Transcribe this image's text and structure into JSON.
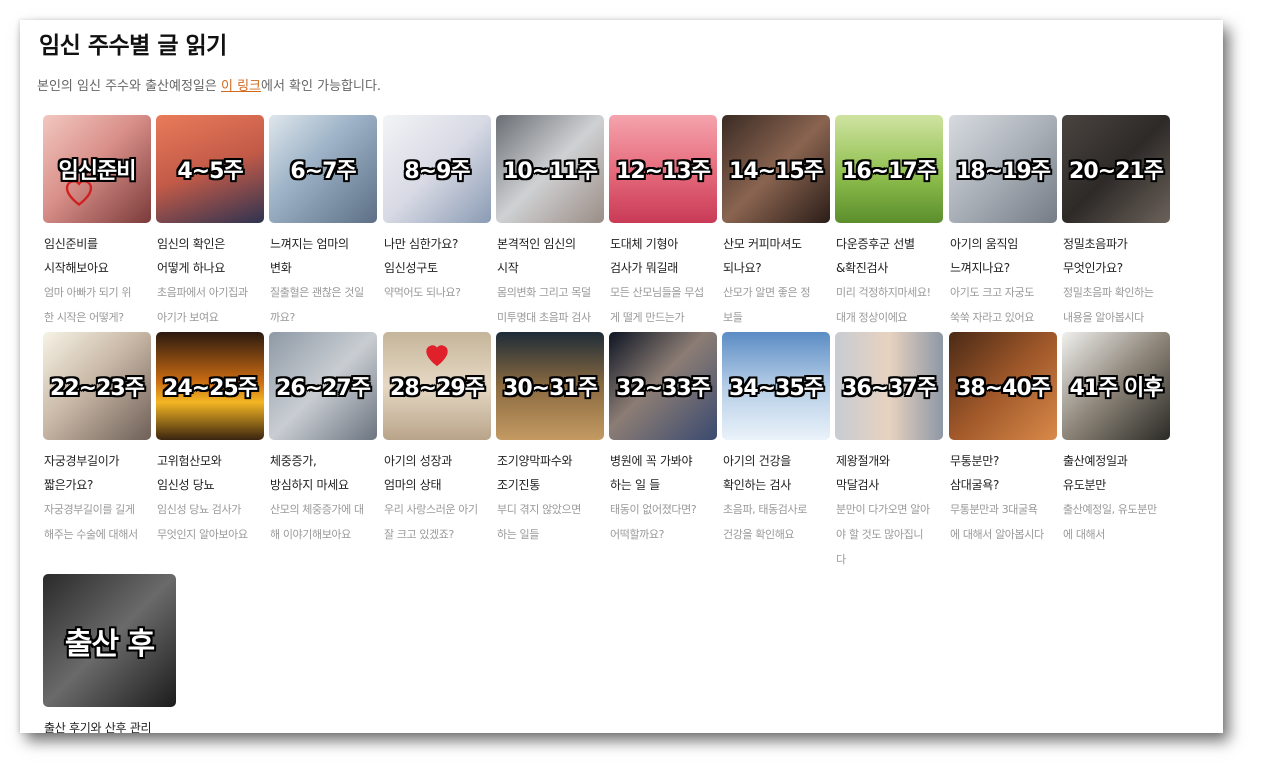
{
  "page": {
    "title": "임신 주수별 글 읽기",
    "intro_prefix": "본인의 임신 주수와 출산예정일은 ",
    "intro_link": "이 링크",
    "intro_suffix": "에서 확인 가능합니다."
  },
  "cards": [
    {
      "label": "임신준비",
      "title": "임신준비를\n시작해보아요",
      "desc": "엄마 아빠가 되기 위\n한 시작은 어떻게?",
      "bg": "linear-gradient(135deg,#f2c7c0 0%,#d98f89 45%,#7a3b3a 100%)"
    },
    {
      "label": "4~5주",
      "title": "임신의 확인은\n어떻게 하나요",
      "desc": "초음파에서 아기집과\n아기가 보여요",
      "bg": "linear-gradient(160deg,#e97b5a 0%,#c25a48 50%,#2e3350 100%)"
    },
    {
      "label": "6~7주",
      "title": "느껴지는 엄마의\n변화",
      "desc": "질출혈은 괜찮은 것일\n까요?",
      "bg": "linear-gradient(135deg,#dfe6ec 0%,#9fb4c8 40%,#5c6f86 100%)"
    },
    {
      "label": "8~9주",
      "title": "나만 심한가요?\n임신성구토",
      "desc": "약먹어도 되나요?",
      "bg": "linear-gradient(135deg,#f3f4f6 0%,#d7d9e4 50%,#8a9bb4 100%)"
    },
    {
      "label": "10~11주",
      "title": "본격적인 임신의\n시작",
      "desc": "몸의변화 그리고 목덜\n미투명대 초음파 검사",
      "bg": "linear-gradient(135deg,#6a6e74 0%,#cfd1d3 50%,#9b8d86 100%)"
    },
    {
      "label": "12~13주",
      "title": "도대체 기형아\n검사가 뭐길래",
      "desc": "모든 산모님들을 무섭\n게 떨게 만드는가",
      "bg": "linear-gradient(180deg,#f4a4ad 0%,#e76d7e 50%,#c93a56 100%)"
    },
    {
      "label": "14~15주",
      "title": "산모 커피마셔도\n되나요?",
      "desc": "산모가 알면 좋은 정\n보들",
      "bg": "linear-gradient(135deg,#3a2b24 0%,#8a6450 50%,#2a1d18 100%)"
    },
    {
      "label": "16~17주",
      "title": "다운증후군 선별\n&확진검사",
      "desc": "미리 걱정하지마세요!\n대개 정상이에요",
      "bg": "linear-gradient(180deg,#cfe3a1 0%,#8fbf4e 55%,#5b8e2c 100%)"
    },
    {
      "label": "18~19주",
      "title": "아기의 움직임\n느껴지나요?",
      "desc": "아기도 크고 자궁도\n쑥쑥 자라고 있어요",
      "bg": "linear-gradient(135deg,#d7dbe0 0%,#a9afb7 50%,#747c86 100%)"
    },
    {
      "label": "20~21주",
      "title": "정밀초음파가\n무엇인가요?",
      "desc": "정밀초음파 확인하는\n내용을 알아봅시다",
      "bg": "linear-gradient(135deg,#4a4440 0%,#2e2a28 50%,#6b625a 100%)"
    },
    {
      "label": "22~23주",
      "title": "자궁경부길이가\n짧은가요?",
      "desc": "자궁경부길이를 길게\n해주는 수술에 대해서",
      "bg": "linear-gradient(135deg,#f6f3e6 0%,#c9b8a6 45%,#6e5f58 100%)"
    },
    {
      "label": "24~25주",
      "title": "고위험산모와\n임신성 당뇨",
      "desc": "임신성 당뇨 검사가\n무엇인지 알아보아요",
      "bg": "linear-gradient(180deg,#2a1a10 0%,#c86a12 45%,#f4b623 65%,#3a240f 100%)"
    },
    {
      "label": "26~27주",
      "title": "체중증가,\n방심하지 마세요",
      "desc": "산모의 체중증가에 대\n해 이야기해보아요",
      "bg": "linear-gradient(135deg,#8e9aa6 0%,#c9cdd2 50%,#6b7480 100%)"
    },
    {
      "label": "28~29주",
      "title": "아기의 성장과\n엄마의 상태",
      "desc": "우리 사랑스러운 아기\n잘 크고 있겠죠?",
      "bg": "linear-gradient(180deg,#c5b59a 0%,#e6d8c4 50%,#b8a48a 100%)"
    },
    {
      "label": "30~31주",
      "title": "조기양막파수와\n조기진통",
      "desc": "부디 겪지 않았으면\n하는 일들",
      "bg": "linear-gradient(180deg,#1e2c38 0%,#8a6a40 50%,#c49a62 100%)"
    },
    {
      "label": "32~33주",
      "title": "병원에 꼭 가봐야\n하는 일 들",
      "desc": "태동이 없어졌다면?\n어떡할까요?",
      "bg": "linear-gradient(135deg,#0e1524 0%,#8c7d74 45%,#3a4a70 100%)"
    },
    {
      "label": "34~35주",
      "title": "아기의 건강을\n확인하는 검사",
      "desc": "초음파, 태동검사로\n건강을 확인해요",
      "bg": "linear-gradient(180deg,#5a8cc4 0%,#b5cde6 50%,#eaf2fa 100%)"
    },
    {
      "label": "36~37주",
      "title": "제왕절개와\n막달검사",
      "desc": "분만이 다가오면 알아\n야 할 것도 많아집니\n다",
      "bg": "linear-gradient(90deg,#c8ccd2 0%,#e8d2c0 50%,#8e98a6 100%)"
    },
    {
      "label": "38~40주",
      "title": "무통분만?\n삼대굴욕?",
      "desc": "무통분만과 3대굴욕\n에 대해서 알아봅시다",
      "bg": "linear-gradient(135deg,#4a2a16 0%,#a0582a 50%,#d98a4a 100%)"
    },
    {
      "label": "41주 이후",
      "title": "출산예정일과\n유도분만",
      "desc": "출산예정일, 유도분만\n에 대해서",
      "bg": "linear-gradient(135deg,#f0f0ee 0%,#8c8478 50%,#2a2a26 100%)"
    },
    {
      "label": "출산 후",
      "title": "출산 후기와 산후 관리",
      "desc": "",
      "bg": "linear-gradient(135deg,#2a2a2a 0%,#6a6a6a 50%,#1c1c1c 100%)"
    }
  ]
}
